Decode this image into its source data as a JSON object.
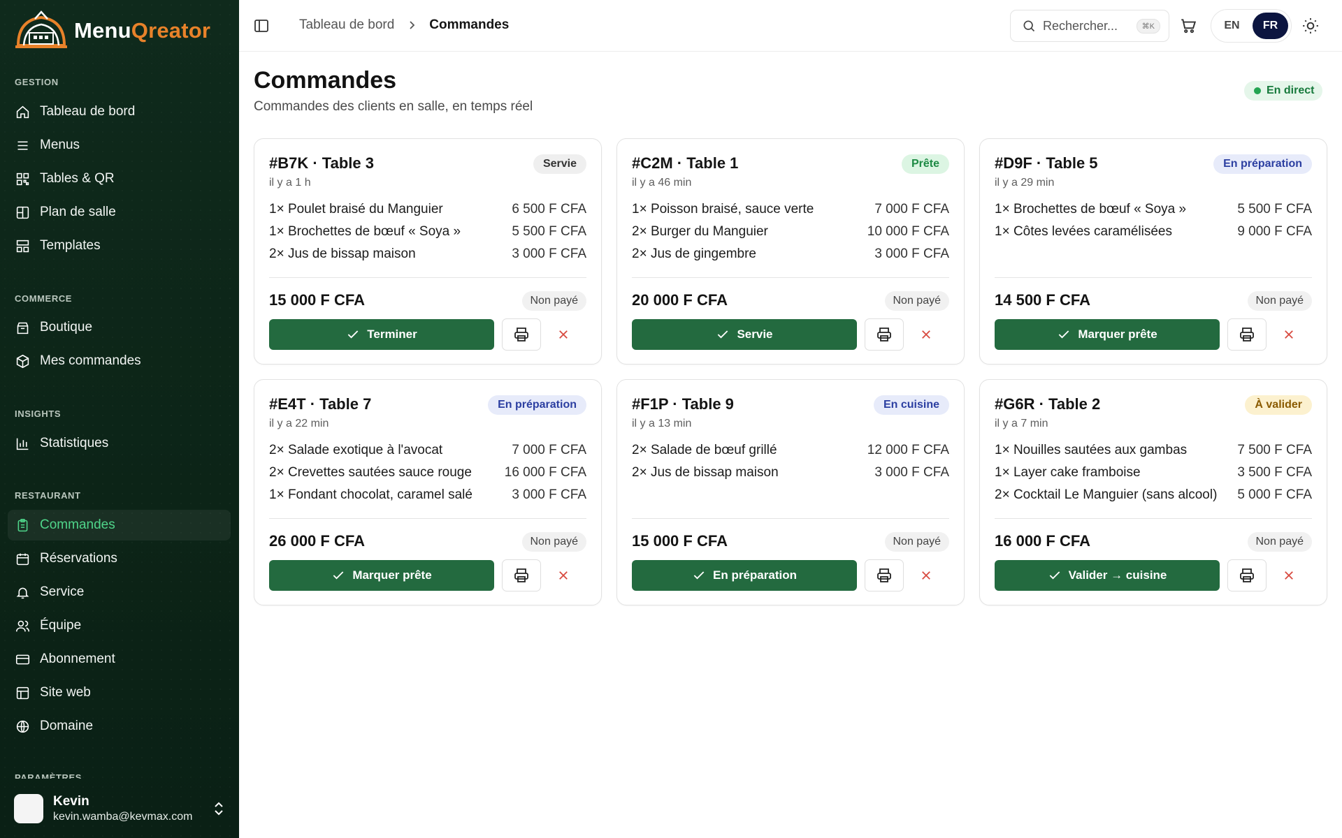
{
  "brand": {
    "name_part1": "Menu",
    "name_part2": "Qreator",
    "accent": "#e8822a"
  },
  "sidebar": {
    "sections": [
      {
        "label": "GESTION",
        "items": [
          {
            "label": "Tableau de bord",
            "icon": "home-icon"
          },
          {
            "label": "Menus",
            "icon": "list-icon"
          },
          {
            "label": "Tables & QR",
            "icon": "qr-icon"
          },
          {
            "label": "Plan de salle",
            "icon": "floor-plan-icon"
          },
          {
            "label": "Templates",
            "icon": "template-icon"
          }
        ]
      },
      {
        "label": "COMMERCE",
        "items": [
          {
            "label": "Boutique",
            "icon": "store-icon"
          },
          {
            "label": "Mes commandes",
            "icon": "package-icon"
          }
        ]
      },
      {
        "label": "INSIGHTS",
        "items": [
          {
            "label": "Statistiques",
            "icon": "bar-chart-icon"
          }
        ]
      },
      {
        "label": "RESTAURANT",
        "items": [
          {
            "label": "Commandes",
            "icon": "clipboard-icon",
            "active": true
          },
          {
            "label": "Réservations",
            "icon": "calendar-icon"
          },
          {
            "label": "Service",
            "icon": "bell-icon"
          },
          {
            "label": "Équipe",
            "icon": "users-icon"
          },
          {
            "label": "Abonnement",
            "icon": "credit-card-icon"
          },
          {
            "label": "Site web",
            "icon": "layout-icon"
          },
          {
            "label": "Domaine",
            "icon": "globe-icon"
          }
        ]
      },
      {
        "label": "PARAMÈTRES",
        "items": []
      }
    ],
    "user": {
      "name": "Kevin",
      "email": "kevin.wamba@kevmax.com"
    }
  },
  "topbar": {
    "breadcrumb": {
      "parent": "Tableau de bord",
      "current": "Commandes"
    },
    "search": {
      "placeholder": "Rechercher...",
      "shortcut": "⌘K"
    },
    "languages": {
      "en": "EN",
      "fr": "FR",
      "selected": "FR"
    }
  },
  "header": {
    "title": "Commandes",
    "subtitle": "Commandes des clients en salle, en temps réel",
    "live_label": "En direct"
  },
  "orders": [
    {
      "title": "#B7K · Table 3",
      "time": "il y a 1 h",
      "status": "Servie",
      "status_color": "gray",
      "items": [
        {
          "name": "1× Poulet braisé du Manguier",
          "price": "6 500 F CFA"
        },
        {
          "name": "1× Brochettes de bœuf « Soya »",
          "price": "5 500 F CFA"
        },
        {
          "name": "2× Jus de bissap maison",
          "price": "3 000 F CFA"
        }
      ],
      "total": "15 000 F CFA",
      "payment": "Non payé",
      "action": "Terminer"
    },
    {
      "title": "#C2M · Table 1",
      "time": "il y a 46 min",
      "status": "Prête",
      "status_color": "green",
      "items": [
        {
          "name": "1× Poisson braisé, sauce verte",
          "price": "7 000 F CFA"
        },
        {
          "name": "2× Burger du Manguier",
          "price": "10 000 F CFA"
        },
        {
          "name": "2× Jus de gingembre",
          "price": "3 000 F CFA"
        }
      ],
      "total": "20 000 F CFA",
      "payment": "Non payé",
      "action": "Servie"
    },
    {
      "title": "#D9F · Table 5",
      "time": "il y a 29 min",
      "status": "En préparation",
      "status_color": "blue",
      "items": [
        {
          "name": "1× Brochettes de bœuf « Soya »",
          "price": "5 500 F CFA"
        },
        {
          "name": "1× Côtes levées caramélisées",
          "price": "9 000 F CFA"
        }
      ],
      "total": "14 500 F CFA",
      "payment": "Non payé",
      "action": "Marquer prête"
    },
    {
      "title": "#E4T · Table 7",
      "time": "il y a 22 min",
      "status": "En préparation",
      "status_color": "blue",
      "items": [
        {
          "name": "2× Salade exotique à l'avocat",
          "price": "7 000 F CFA"
        },
        {
          "name": "2× Crevettes sautées sauce rouge",
          "price": "16 000 F CFA"
        },
        {
          "name": "1× Fondant chocolat, caramel salé",
          "price": "3 000 F CFA"
        }
      ],
      "total": "26 000 F CFA",
      "payment": "Non payé",
      "action": "Marquer prête"
    },
    {
      "title": "#F1P · Table 9",
      "time": "il y a 13 min",
      "status": "En cuisine",
      "status_color": "blue",
      "items": [
        {
          "name": "2× Salade de bœuf grillé",
          "price": "12 000 F CFA"
        },
        {
          "name": "2× Jus de bissap maison",
          "price": "3 000 F CFA"
        }
      ],
      "total": "15 000 F CFA",
      "payment": "Non payé",
      "action": "En préparation"
    },
    {
      "title": "#G6R · Table 2",
      "time": "il y a 7 min",
      "status": "À valider",
      "status_color": "yellow",
      "items": [
        {
          "name": "1× Nouilles sautées aux gambas",
          "price": "7 500 F CFA"
        },
        {
          "name": "1× Layer cake framboise",
          "price": "3 500 F CFA"
        },
        {
          "name": "2× Cocktail Le Manguier (sans alcool)",
          "price": "5 000 F CFA"
        }
      ],
      "total": "16 000 F CFA",
      "payment": "Non payé",
      "action": "Valider → cuisine"
    }
  ]
}
